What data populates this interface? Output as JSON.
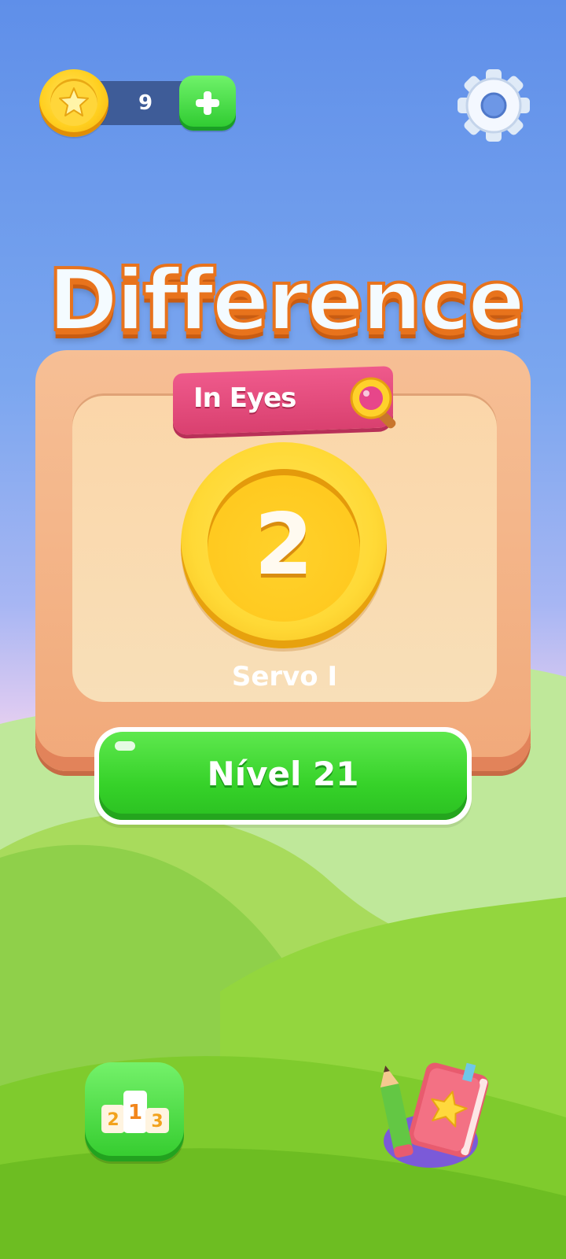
{
  "coins": {
    "count": "9"
  },
  "title": {
    "main": "Difference",
    "subtitle": "In Eyes"
  },
  "rank": {
    "number": "2",
    "name": "Servo I"
  },
  "level_button": {
    "label": "Nível 21"
  },
  "leaderboard": {
    "places": [
      "2",
      "1",
      "3"
    ]
  },
  "icons": {
    "coin": "star-coin-icon",
    "add": "plus-icon",
    "settings": "gear-icon",
    "magnifier": "magnifier-icon",
    "leaderboard": "podium-icon",
    "journal": "journal-pencil-icon"
  },
  "colors": {
    "sky_top": "#5f8fe9",
    "grass": "#7ccf2a",
    "title_outline": "#e8731c",
    "banner": "#e44f7f",
    "button_green": "#36d229",
    "coin_gold": "#ffcf1f"
  }
}
